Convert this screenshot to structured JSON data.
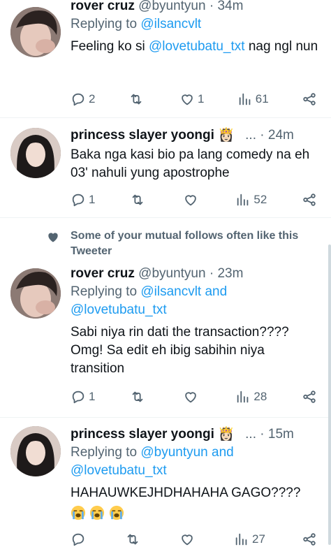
{
  "tweets": [
    {
      "name": "rover cruz",
      "handle": "@byuntyun",
      "time": "· 34m",
      "reply_prefix": "Replying to ",
      "reply_to": "@ilsancvlt",
      "reply_to2": "",
      "text_pre": "Feeling ko si ",
      "text_link": "@lovetubatu_txt",
      "text_post": " nag ngl nun",
      "replies": "2",
      "retweets": "",
      "likes": "1",
      "views": "61"
    },
    {
      "name": "princess slayer yoongi",
      "handle": "",
      "time": "· 24m",
      "badge": "👸🏻",
      "ellipsis": "...",
      "text": "Baka nga kasi bio pa lang comedy na eh 03' nahuli yung apostrophe",
      "replies": "1",
      "retweets": "",
      "likes": "",
      "views": "52"
    },
    {
      "name": "rover cruz",
      "handle": "@byuntyun",
      "time": "· 23m",
      "reply_prefix": "Replying to ",
      "reply_to": "@ilsancvlt and",
      "reply_to2": "@lovetubatu_txt",
      "text": "Sabi niya rin dati the transaction???? Omg! Sa edit eh ibig sabihin niya transition",
      "replies": "1",
      "retweets": "",
      "likes": "",
      "views": "28"
    },
    {
      "name": "princess slayer yoongi",
      "handle": "",
      "time": "· 15m",
      "badge": "👸🏻",
      "ellipsis": "...",
      "reply_prefix": "Replying to ",
      "reply_to": "@byuntyun and",
      "reply_to2": "@lovetubatu_txt",
      "text": "HAHAUWKEJHDHAHAHA GAGO????",
      "replies": "",
      "retweets": "",
      "likes": "",
      "views": "27"
    }
  ],
  "notice": {
    "text": "Some of your mutual follows often like this Tweeter"
  },
  "icons": {
    "reply": "reply-icon",
    "retweet": "retweet-icon",
    "like": "heart-icon",
    "views": "views-icon",
    "share": "share-icon",
    "crying": "loudly-crying-face-icon"
  }
}
